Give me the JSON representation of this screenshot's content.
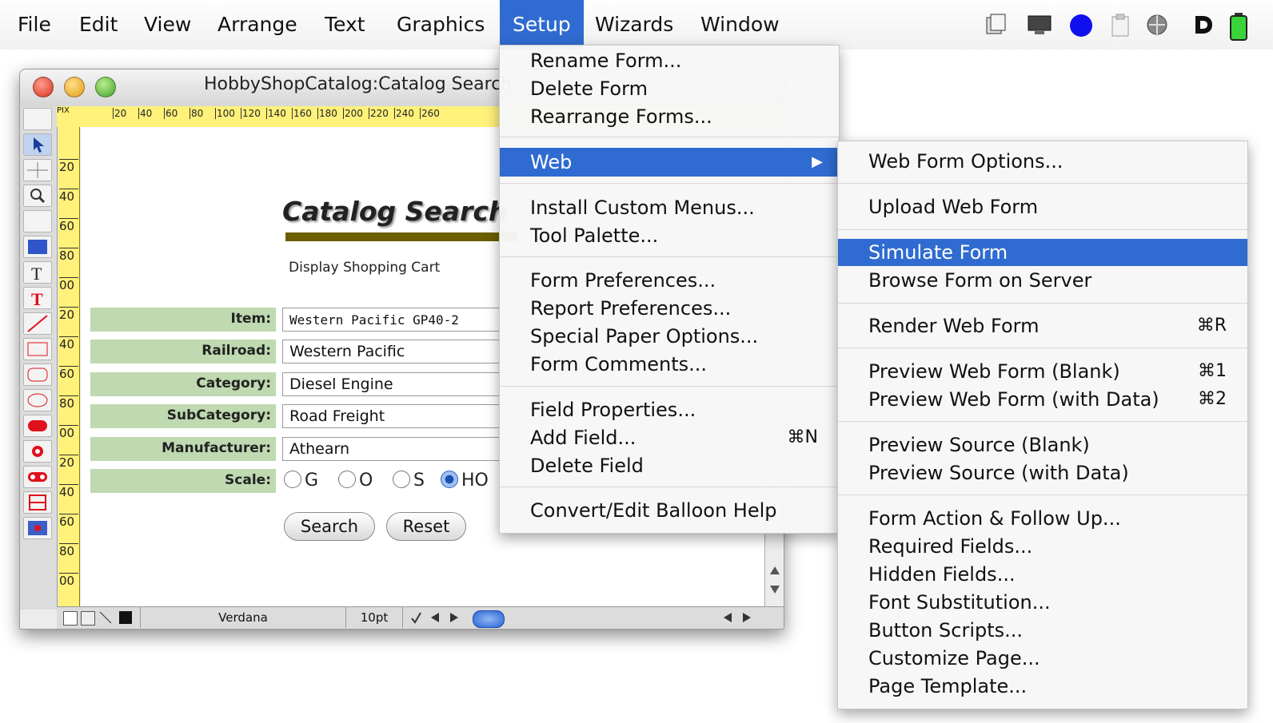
{
  "menubar": {
    "items": [
      "File",
      "Edit",
      "View",
      "Arrange",
      "Text",
      "Graphics",
      "Setup",
      "Wizards",
      "Window"
    ],
    "active_index": 6,
    "accent": "#2f6bd0"
  },
  "window": {
    "title": "HobbyShopCatalog:Catalog Search",
    "ruler_marks": [
      "20",
      "40",
      "60",
      "80",
      "100",
      "120",
      "140",
      "160",
      "180",
      "200",
      "220",
      "240",
      "260"
    ],
    "v_ruler_marks": [
      "20",
      "40",
      "60",
      "80",
      "00",
      "20",
      "40",
      "60",
      "80",
      "00",
      "20",
      "40",
      "60",
      "80",
      "00"
    ],
    "ruler_unit": "PIX"
  },
  "form": {
    "title": "Catalog Search",
    "display_cart": "Display Shopping Cart",
    "fields": [
      {
        "label": "Item:",
        "value": "Western Pacific GP40-2"
      },
      {
        "label": "Railroad:",
        "value": "Western Pacific"
      },
      {
        "label": "Category:",
        "value": "Diesel Engine"
      },
      {
        "label": "SubCategory:",
        "value": "Road Freight"
      },
      {
        "label": "Manufacturer:",
        "value": "Athearn"
      }
    ],
    "scale_label": "Scale:",
    "scale_options": [
      "G",
      "O",
      "S",
      "HO"
    ],
    "scale_selected": "HO",
    "search_button": "Search",
    "reset_button": "Reset"
  },
  "status_bar": {
    "font": "Verdana",
    "size": "10pt"
  },
  "setup_menu": {
    "items": [
      "Rename Form...",
      "Delete Form",
      "Rearrange Forms...",
      "Web",
      "Install Custom Menus...",
      "Tool Palette...",
      "Form Preferences...",
      "Report Preferences...",
      "Special Paper Options...",
      "Form Comments...",
      "Field Properties...",
      "Add Field...",
      "Delete Field",
      "Convert/Edit Balloon Help"
    ],
    "add_field_shortcut": "⌘N",
    "submenu_arrow": "▶"
  },
  "web_submenu": {
    "items": [
      "Web Form Options...",
      "Upload Web Form",
      "Simulate Form",
      "Browse Form on Server",
      "Render Web Form",
      "Preview Web Form (Blank)",
      "Preview Web Form (with Data)",
      "Preview Source (Blank)",
      "Preview Source (with Data)",
      "Form Action & Follow Up...",
      "Required Fields...",
      "Hidden Fields...",
      "Font Substitution...",
      "Button Scripts...",
      "Customize Page...",
      "Page Template..."
    ],
    "shortcuts": {
      "render": "⌘R",
      "preview_blank": "⌘1",
      "preview_data": "⌘2"
    },
    "highlighted": "Simulate Form"
  }
}
